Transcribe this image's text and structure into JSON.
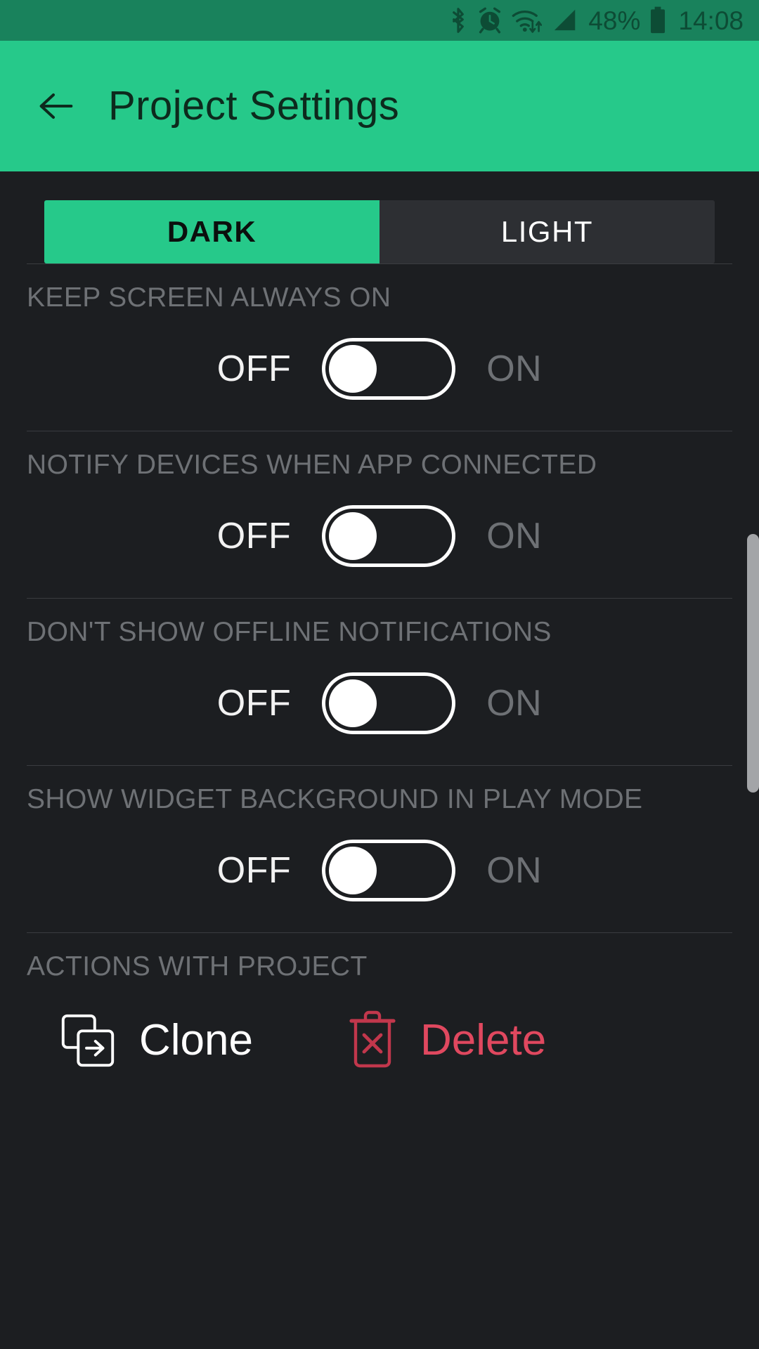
{
  "status_bar": {
    "icons": [
      "bluetooth-icon",
      "alarm-icon",
      "wifi-icon",
      "cellular-signal-icon",
      "battery-icon"
    ],
    "battery_percent": "48%",
    "time": "14:08"
  },
  "header": {
    "back_icon": "back-arrow-icon",
    "title": "Project Settings"
  },
  "theme_tabs": {
    "selected": "DARK",
    "items": [
      {
        "label": "DARK",
        "active": true
      },
      {
        "label": "LIGHT",
        "active": false
      }
    ]
  },
  "settings": {
    "off_label": "OFF",
    "on_label": "ON",
    "rows": [
      {
        "label": "KEEP SCREEN ALWAYS ON",
        "value": "OFF"
      },
      {
        "label": "NOTIFY DEVICES WHEN APP CONNECTED",
        "value": "OFF"
      },
      {
        "label": "DON'T SHOW OFFLINE NOTIFICATIONS",
        "value": "OFF"
      },
      {
        "label": "SHOW WIDGET BACKGROUND IN PLAY MODE",
        "value": "OFF"
      }
    ]
  },
  "actions": {
    "section_label": "ACTIONS WITH PROJECT",
    "clone": {
      "label": "Clone",
      "icon": "clone-icon"
    },
    "delete": {
      "label": "Delete",
      "icon": "trash-delete-icon"
    }
  },
  "colors": {
    "accent_green": "#26c98a",
    "statusbar_green": "#19825c",
    "background": "#1c1e21",
    "tab_inactive": "#2d2f33",
    "label_gray": "#6e7175",
    "danger_red": "#e0485f",
    "scrollbar": "#a3a5a8"
  }
}
